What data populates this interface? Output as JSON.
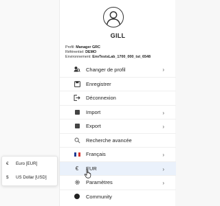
{
  "user": {
    "name": "GILL",
    "profile_label": "Profil:",
    "profile_value": "Manager GRC",
    "repo_label": "Référentiel:",
    "repo_value": "DEMO",
    "env_label": "Environnement:",
    "env_value": "EnvTestsLab_1700_000_tst_6548"
  },
  "menu": {
    "change_profile": "Changer de profil",
    "save": "Enregistrer",
    "logout": "Déconnexion",
    "import": "Import",
    "export": "Export",
    "advanced_search": "Recherche avancée",
    "language": "Français",
    "currency": "EUR",
    "settings": "Paramètres",
    "community": "Community"
  },
  "currency_options": [
    {
      "symbol": "€",
      "label": "Euro [EUR]"
    },
    {
      "symbol": "$",
      "label": "US Dollar [USD]"
    }
  ],
  "colors": {
    "active_row": "#eaf1fb",
    "flag_blue": "#1f3a93",
    "flag_red": "#d6342c"
  }
}
